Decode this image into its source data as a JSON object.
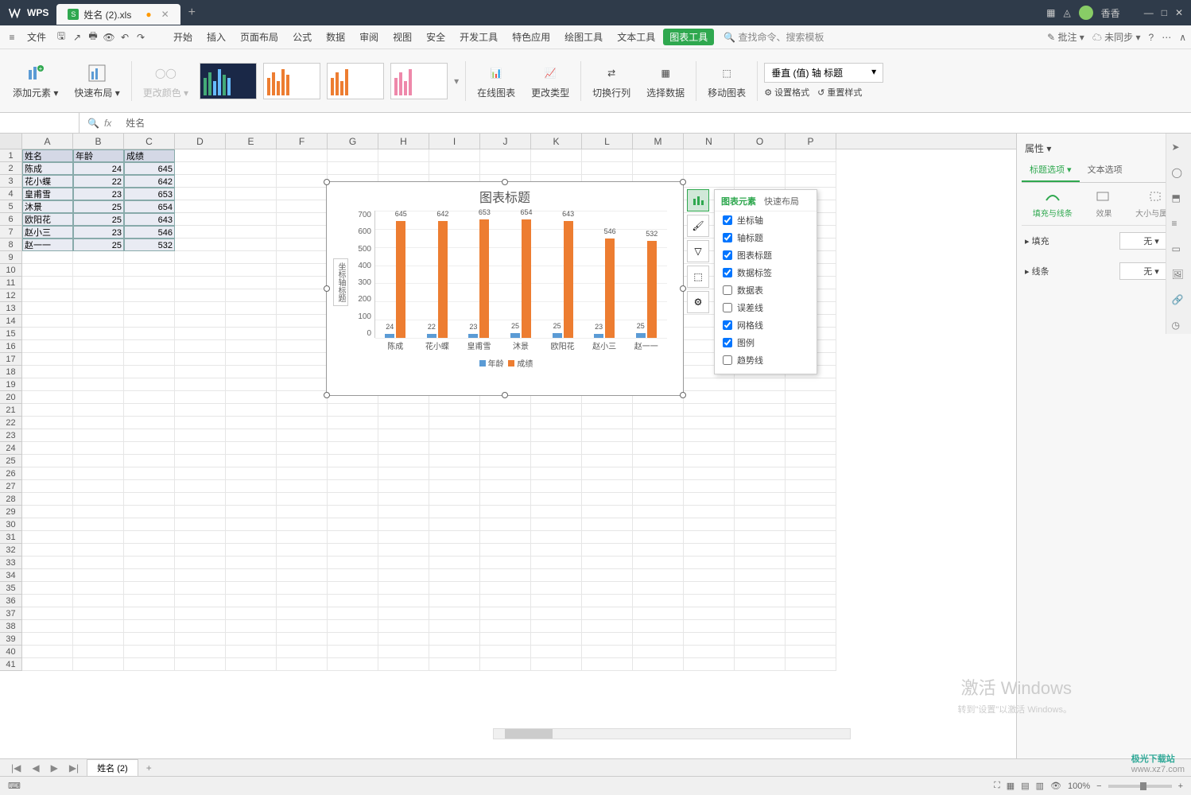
{
  "app": {
    "name": "WPS",
    "tab_file": "姓名 (2).xls",
    "tab_add": "+"
  },
  "user": {
    "name": "香香"
  },
  "menu": {
    "file": "文件",
    "items": [
      "开始",
      "插入",
      "页面布局",
      "公式",
      "数据",
      "审阅",
      "视图",
      "安全",
      "开发工具",
      "特色应用",
      "绘图工具",
      "文本工具"
    ],
    "active": "图表工具",
    "search": "查找命令、搜索模板",
    "right": {
      "batch": "批注 ▾",
      "sync": "未同步 ▾"
    }
  },
  "ribbon": {
    "add_element": "添加元素 ▾",
    "quick_layout": "快速布局 ▾",
    "change_color": "更改颜色 ▾",
    "online_chart": "在线图表",
    "change_type": "更改类型",
    "switch_rc": "切换行列",
    "select_data": "选择数据",
    "move_chart": "移动图表",
    "axis_select": "垂直 (值) 轴 标题",
    "set_format": "设置格式",
    "reset_style": "重置样式"
  },
  "formula": {
    "namebox": "",
    "value": "姓名",
    "fx": "fx"
  },
  "columns": [
    "A",
    "B",
    "C",
    "D",
    "E",
    "F",
    "G",
    "H",
    "I",
    "J",
    "K",
    "L",
    "M",
    "N",
    "O",
    "P"
  ],
  "table": {
    "headers": [
      "姓名",
      "年龄",
      "成绩"
    ],
    "rows": [
      [
        "陈成",
        "24",
        "645"
      ],
      [
        "花小蝶",
        "22",
        "642"
      ],
      [
        "皇甫雪",
        "23",
        "653"
      ],
      [
        "沐景",
        "25",
        "654"
      ],
      [
        "欧阳花",
        "25",
        "643"
      ],
      [
        "赵小三",
        "23",
        "546"
      ],
      [
        "赵一一",
        "25",
        "532"
      ]
    ]
  },
  "chart_data": {
    "type": "bar",
    "title": "图表标题",
    "axis_title": "坐标轴标题",
    "categories": [
      "陈成",
      "花小蝶",
      "皇甫雪",
      "沐景",
      "欧阳花",
      "赵小三",
      "赵一一"
    ],
    "series": [
      {
        "name": "年龄",
        "values": [
          24,
          22,
          23,
          25,
          25,
          23,
          25
        ],
        "color": "#5b9bd5"
      },
      {
        "name": "成绩",
        "values": [
          645,
          642,
          653,
          654,
          643,
          546,
          532
        ],
        "color": "#ed7d31"
      }
    ],
    "ylim": [
      0,
      700
    ],
    "yticks": [
      0,
      100,
      200,
      300,
      400,
      500,
      600,
      700
    ]
  },
  "chart_popup": {
    "tab1": "图表元素",
    "tab2": "快速布局",
    "items": [
      {
        "label": "坐标轴",
        "checked": true
      },
      {
        "label": "轴标题",
        "checked": true
      },
      {
        "label": "图表标题",
        "checked": true
      },
      {
        "label": "数据标签",
        "checked": true
      },
      {
        "label": "数据表",
        "checked": false
      },
      {
        "label": "误差线",
        "checked": false
      },
      {
        "label": "网格线",
        "checked": true
      },
      {
        "label": "图例",
        "checked": true
      },
      {
        "label": "趋势线",
        "checked": false
      }
    ]
  },
  "panel": {
    "title": "属性 ▾",
    "tab_title": "标题选项 ▾",
    "tab_text": "文本选项",
    "sub": {
      "fill": "填充与线条",
      "effect": "效果",
      "size": "大小与属性"
    },
    "fill_label": "填充",
    "fill_value": "无",
    "line_label": "线条",
    "line_value": "无"
  },
  "sheet_tab": "姓名 (2)",
  "status": {
    "zoom": "100%"
  },
  "watermark": {
    "l1": "激活 Windows",
    "l2": "转到\"设置\"以激活 Windows。",
    "brand": "极光下载站",
    "url": "www.xz7.com"
  }
}
